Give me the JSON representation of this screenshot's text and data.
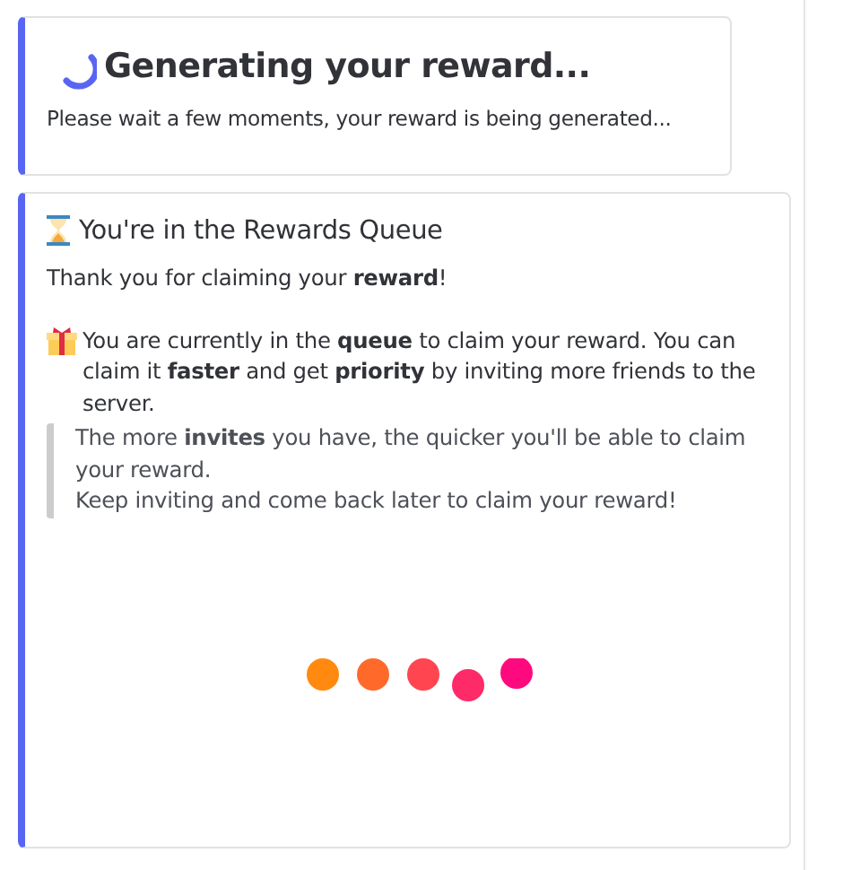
{
  "status_card": {
    "title": "Generating your reward...",
    "message": "Please wait a few moments, your reward is being generated..."
  },
  "queue_card": {
    "title": "You're in the Rewards Queue",
    "paragraphs": [
      "Thank you for claiming your **reward**!",
      "You are currently in the **queue** to claim your reward. You can claim it **faster** and get **priority** by inviting more friends to the server."
    ],
    "quote": [
      "The more **invites** you have, the quicker you'll be able to claim your reward.",
      "Keep inviting and come back later to claim your reward!"
    ]
  }
}
